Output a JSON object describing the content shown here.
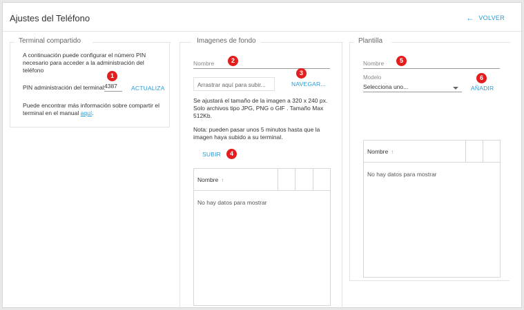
{
  "header": {
    "title": "Ajustes del Teléfono",
    "back_label": "VOLVER",
    "back_icon": "arrow-left-icon"
  },
  "colors": {
    "accent": "#2a9bd7",
    "badge": "#e41e1e"
  },
  "terminal": {
    "legend": "Terminal compartido",
    "intro": "A continuación puede configurar el número PIN necesario para acceder a la administración del teléfono",
    "pin_label": "PIN administración del terminal:",
    "pin_value": "4387",
    "update_label": "ACTUALIZA",
    "more_info_pre": "Puede encontrar más información sobre compartir el terminal en el manual ",
    "more_info_link": "aquí",
    "more_info_post": "."
  },
  "backgrounds": {
    "legend": "Imagenes de fondo",
    "name_placeholder": "Nombre",
    "drop_text": "Arrastrar aquí para subir...",
    "browse_label": "NAVEGAR...",
    "info": "Se ajustará el tamaño de la imagen a 320 x 240 px. Solo archivos tipo JPG, PNG o GIF . Tamaño Max 512Kb.",
    "note": "Nota: pueden pasar unos 5 minutos hasta que la imagen haya subido a su terminal.",
    "upload_label": "SUBIR",
    "table": {
      "column": "Nombre",
      "sort_icon": "sort-arrow-up-icon",
      "empty": "No hay datos para mostrar"
    }
  },
  "template": {
    "legend": "Plantilla",
    "name_placeholder": "Nombre",
    "model_label": "Modelo",
    "model_selected": "Selecciona uno...",
    "add_label": "AÑADIR",
    "table": {
      "column": "Nombre",
      "sort_icon": "sort-arrow-up-icon",
      "empty": "No hay datos para mostrar"
    }
  },
  "badges": [
    "1",
    "2",
    "3",
    "4",
    "5",
    "6"
  ]
}
